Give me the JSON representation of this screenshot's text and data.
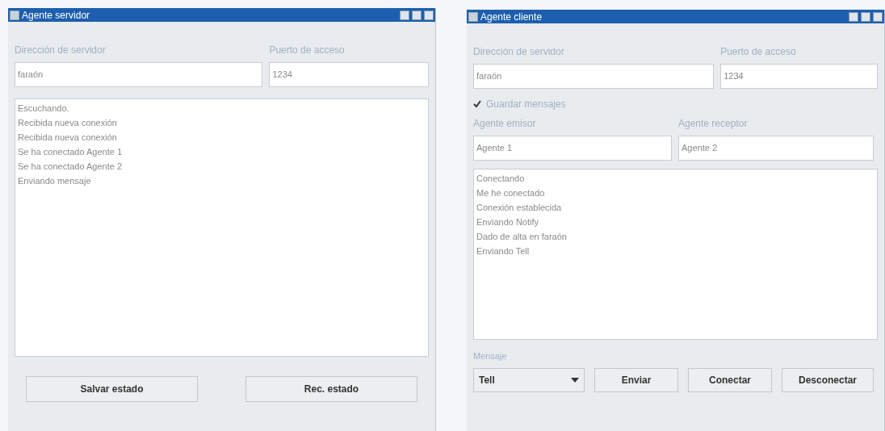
{
  "windows": [
    {
      "title": "Agente servidor",
      "fields": [
        {
          "label": "Dirección de servidor",
          "value": "faraón"
        },
        {
          "label": "Puerto de acceso",
          "value": "1234"
        }
      ],
      "log": [
        "Escuchando.",
        "Recibida nueva conexión",
        "Recibida nueva conexión",
        "Se ha conectado Agente 1",
        "Se ha conectado Agente 2",
        "Enviando mensaje"
      ],
      "buttons": [
        "Salvar estado",
        "Rec. estado"
      ]
    },
    {
      "title": "Agente cliente",
      "fields": [
        {
          "label": "Dirección de servidor",
          "value": "faraón"
        },
        {
          "label": "Puerto de acceso",
          "value": "1234"
        }
      ],
      "checkbox": {
        "label": "Guardar mensajes",
        "checked": true
      },
      "agent_fields": [
        {
          "label": "Agente emisor",
          "value": "Agente 1"
        },
        {
          "label": "Agente receptor",
          "value": "Agente 2"
        }
      ],
      "log": [
        "Conectando",
        "Me he conectado",
        "Conexión establecida",
        "Enviando Notify",
        "Dado de alta en faraón",
        "Enviando Tell"
      ],
      "message": {
        "label": "Mensaje",
        "value": "Tell"
      },
      "buttons": [
        "Enviar",
        "Conectar",
        "Desconectar"
      ]
    }
  ]
}
